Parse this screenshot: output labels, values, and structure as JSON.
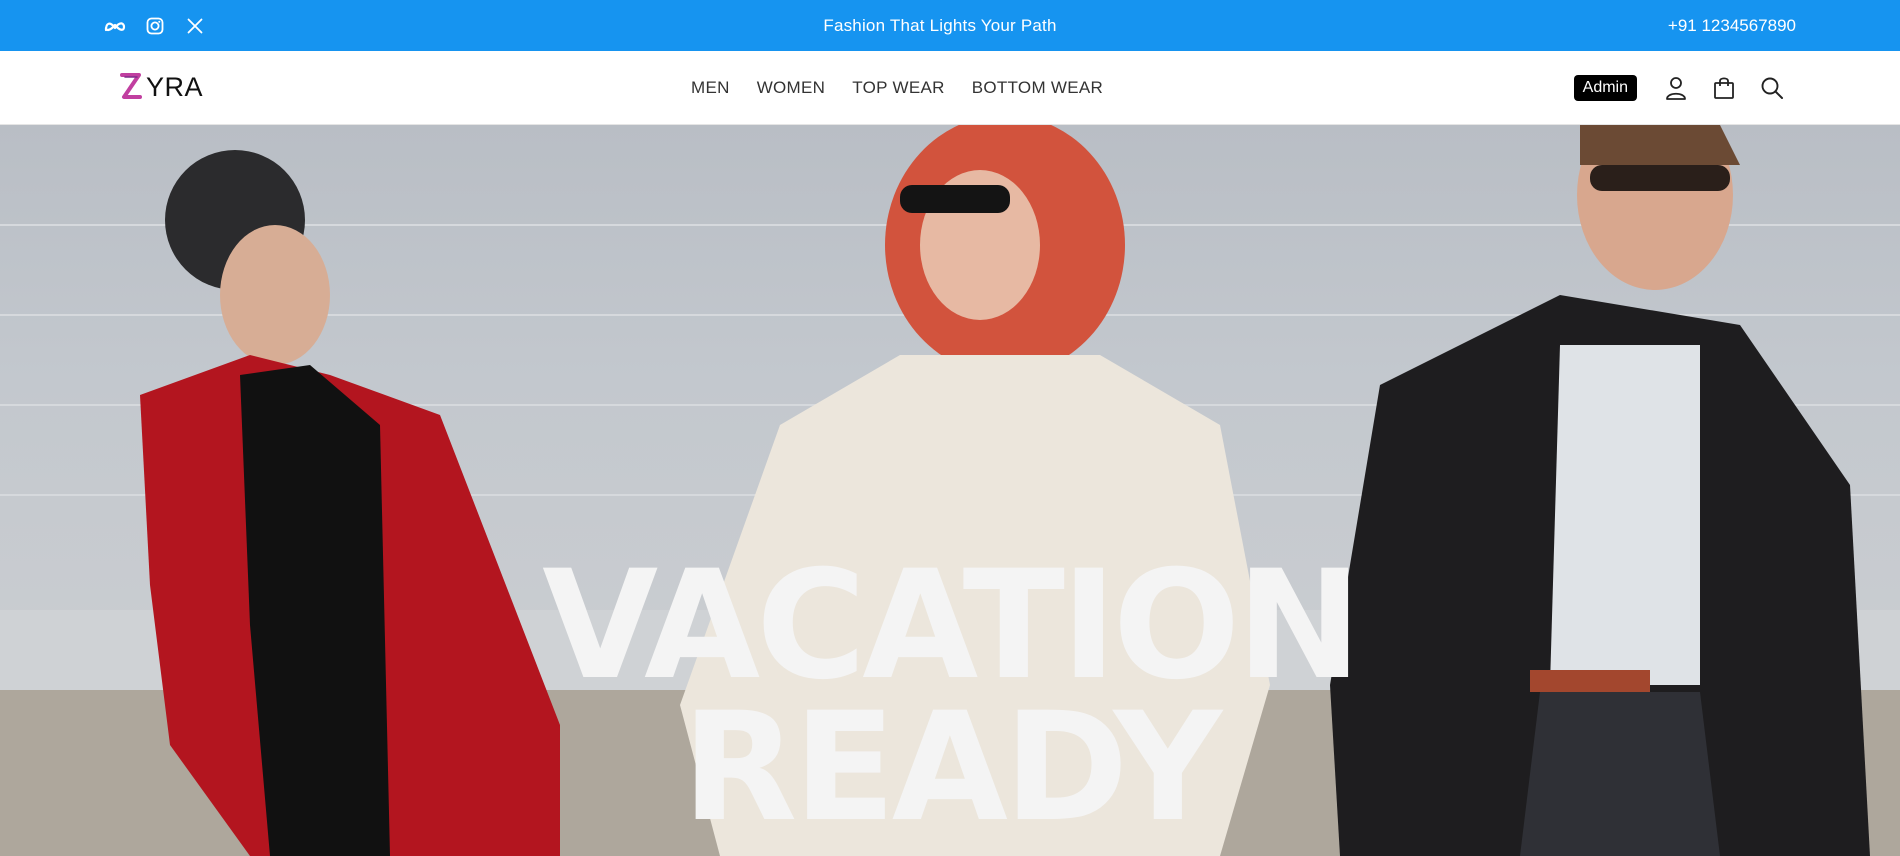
{
  "topbar": {
    "socials": [
      {
        "icon": "meta-icon"
      },
      {
        "icon": "instagram-icon"
      },
      {
        "icon": "x-icon"
      }
    ],
    "tagline": "Fashion That Lights Your Path",
    "phone": "+91 1234567890",
    "bg_color": "#1694f0"
  },
  "navbar": {
    "logo_text": "YRA",
    "logo_mark_color": "#c13fa0",
    "menu": [
      "MEN",
      "WOMEN",
      "TOP WEAR",
      "BOTTOM WEAR"
    ],
    "admin_label": "Admin",
    "icons": [
      "user-icon",
      "shopping-bag-icon",
      "search-icon"
    ]
  },
  "hero": {
    "title_line1": "VACATION",
    "title_line2": "READY",
    "image": "Three people in jackets leaning against a light gray wall"
  }
}
